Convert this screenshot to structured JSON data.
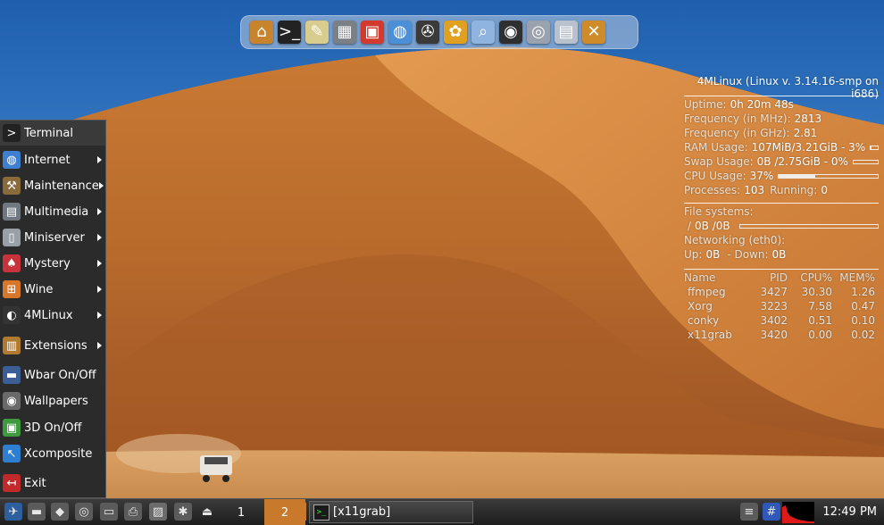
{
  "dock": {
    "icons": [
      {
        "name": "home-folder-icon",
        "glyph": "⌂",
        "bg": "#c8842c"
      },
      {
        "name": "terminal-icon",
        "glyph": ">_",
        "bg": "#222222"
      },
      {
        "name": "text-editor-icon",
        "glyph": "✎",
        "bg": "#d9cc8f"
      },
      {
        "name": "calculator-icon",
        "glyph": "▦",
        "bg": "#7b7f86"
      },
      {
        "name": "calendar-icon",
        "glyph": "▣",
        "bg": "#d23a2e"
      },
      {
        "name": "web-browser-icon",
        "glyph": "◍",
        "bg": "#4d8fd6"
      },
      {
        "name": "video-player-icon",
        "glyph": "✇",
        "bg": "#3a3a3a"
      },
      {
        "name": "image-viewer-icon",
        "glyph": "✿",
        "bg": "#e0a020"
      },
      {
        "name": "search-icon",
        "glyph": "⌕",
        "bg": "#8fb4e0"
      },
      {
        "name": "camera-icon",
        "glyph": "◉",
        "bg": "#2f2f2f"
      },
      {
        "name": "webcam-icon",
        "glyph": "◎",
        "bg": "#9aa3ad"
      },
      {
        "name": "screenshot-icon",
        "glyph": "▤",
        "bg": "#b9c2cc"
      },
      {
        "name": "tools-icon",
        "glyph": "✕",
        "bg": "#cf8a2a"
      }
    ]
  },
  "conky": {
    "title": "4MLinux (Linux v. 3.14.16-smp on i686)",
    "uptime": {
      "label": "Uptime:",
      "value": "0h 20m 48s"
    },
    "freq_mhz": {
      "label": "Frequency (in MHz):",
      "value": "2813"
    },
    "freq_ghz": {
      "label": "Frequency (in GHz):",
      "value": "2.81"
    },
    "ram": {
      "label": "RAM Usage:",
      "value": "107MiB/3.21GiB - 3%",
      "percent": 3
    },
    "swap": {
      "label": "Swap Usage:",
      "value": "0B  /2.75GiB - 0%",
      "percent": 0
    },
    "cpu": {
      "label": "CPU Usage:",
      "value": "37%",
      "percent": 37
    },
    "processes": {
      "label": "Processes:",
      "value": "103",
      "running_label": "Running:",
      "running_value": "0"
    },
    "fs_title": "File systems:",
    "fs_root": {
      "mount": "/",
      "value": "0B  /0B",
      "percent": 0
    },
    "net_title": "Networking (eth0):",
    "net": {
      "up_label": "Up:",
      "up_value": "0B",
      "down_label": "- Down:",
      "down_value": "0B"
    },
    "proc_headers": [
      "Name",
      "PID",
      "CPU%",
      "MEM%"
    ],
    "proc_rows": [
      [
        "ffmpeg",
        "3427",
        "30.30",
        "1.26"
      ],
      [
        "Xorg",
        "3223",
        "7.58",
        "0.47"
      ],
      [
        "conky",
        "3402",
        "0.51",
        "0.10"
      ],
      [
        "x11grab",
        "3420",
        "0.00",
        "0.02"
      ]
    ]
  },
  "menu": {
    "items": [
      {
        "id": "terminal",
        "label": "Terminal",
        "icon": "terminal-icon",
        "glyph": ">",
        "bg": "#222222",
        "submenu": false
      },
      {
        "id": "internet",
        "label": "Internet",
        "icon": "globe-icon",
        "glyph": "◍",
        "bg": "#3f7fd0",
        "submenu": true
      },
      {
        "id": "maintenance",
        "label": "Maintenance",
        "icon": "hammer-icon",
        "glyph": "⚒",
        "bg": "#8a6a3a",
        "submenu": true
      },
      {
        "id": "multimedia",
        "label": "Multimedia",
        "icon": "multimedia-icon",
        "glyph": "▤",
        "bg": "#6f7780",
        "submenu": true
      },
      {
        "id": "miniserver",
        "label": "Miniserver",
        "icon": "server-icon",
        "glyph": "▯",
        "bg": "#9aa0a8",
        "submenu": true
      },
      {
        "id": "mystery",
        "label": "Mystery",
        "icon": "cards-icon",
        "glyph": "♠",
        "bg": "#c8323a",
        "submenu": true
      },
      {
        "id": "wine",
        "label": "Wine",
        "icon": "windows-icon",
        "glyph": "⊞",
        "bg": "#d8762a",
        "submenu": true
      },
      {
        "id": "4mlinux",
        "label": "4MLinux",
        "icon": "penguin-icon",
        "glyph": "◐",
        "bg": "#333333",
        "submenu": true
      },
      {
        "id": "extensions",
        "label": "Extensions",
        "icon": "extensions-icon",
        "glyph": "▥",
        "bg": "#b07a30",
        "submenu": true
      },
      {
        "id": "wbar",
        "label": "Wbar On/Off",
        "icon": "wbar-icon",
        "glyph": "▬",
        "bg": "#3c5e96",
        "submenu": false
      },
      {
        "id": "wallpapers",
        "label": "Wallpapers",
        "icon": "eye-icon",
        "glyph": "◉",
        "bg": "#6a6a6a",
        "submenu": false
      },
      {
        "id": "3d",
        "label": "3D On/Off",
        "icon": "cube-3d-icon",
        "glyph": "▣",
        "bg": "#3f9a3f",
        "submenu": false
      },
      {
        "id": "xcomposite",
        "label": "Xcomposite",
        "icon": "xcomposite-icon",
        "glyph": "↖",
        "bg": "#2e7fcf",
        "submenu": false
      },
      {
        "id": "exit",
        "label": "Exit",
        "icon": "exit-icon",
        "glyph": "↤",
        "bg": "#c02a2a",
        "submenu": false
      }
    ]
  },
  "taskbar": {
    "launchers": [
      {
        "name": "jwm-menu-icon",
        "glyph": "✈",
        "bg": "#2d5f9e"
      },
      {
        "name": "drive-icon",
        "glyph": "▬",
        "bg": "#5b5b5b"
      },
      {
        "name": "usb-drive-icon",
        "glyph": "◆",
        "bg": "#5b5b5b"
      },
      {
        "name": "cdrom-icon",
        "glyph": "◎",
        "bg": "#5b5b5b"
      },
      {
        "name": "floppy-icon",
        "glyph": "▭",
        "bg": "#5b5b5b"
      },
      {
        "name": "printer-icon",
        "glyph": "⎙",
        "bg": "#5b5b5b"
      },
      {
        "name": "image-editor-icon",
        "glyph": "▨",
        "bg": "#6b6b6b"
      },
      {
        "name": "bluetooth-icon",
        "glyph": "✱",
        "bg": "#5b5b5b"
      },
      {
        "name": "eject-icon",
        "glyph": "⏏",
        "bg": "transparent"
      }
    ],
    "pager": [
      "1",
      "2"
    ],
    "task_label": "[x11grab]",
    "tray": [
      {
        "name": "mixer-icon",
        "glyph": "≡",
        "bg": "#5b5b5b"
      },
      {
        "name": "calendar-tray-icon",
        "glyph": "#",
        "bg": "#2f58b8"
      }
    ],
    "clock": "12:49 PM"
  }
}
